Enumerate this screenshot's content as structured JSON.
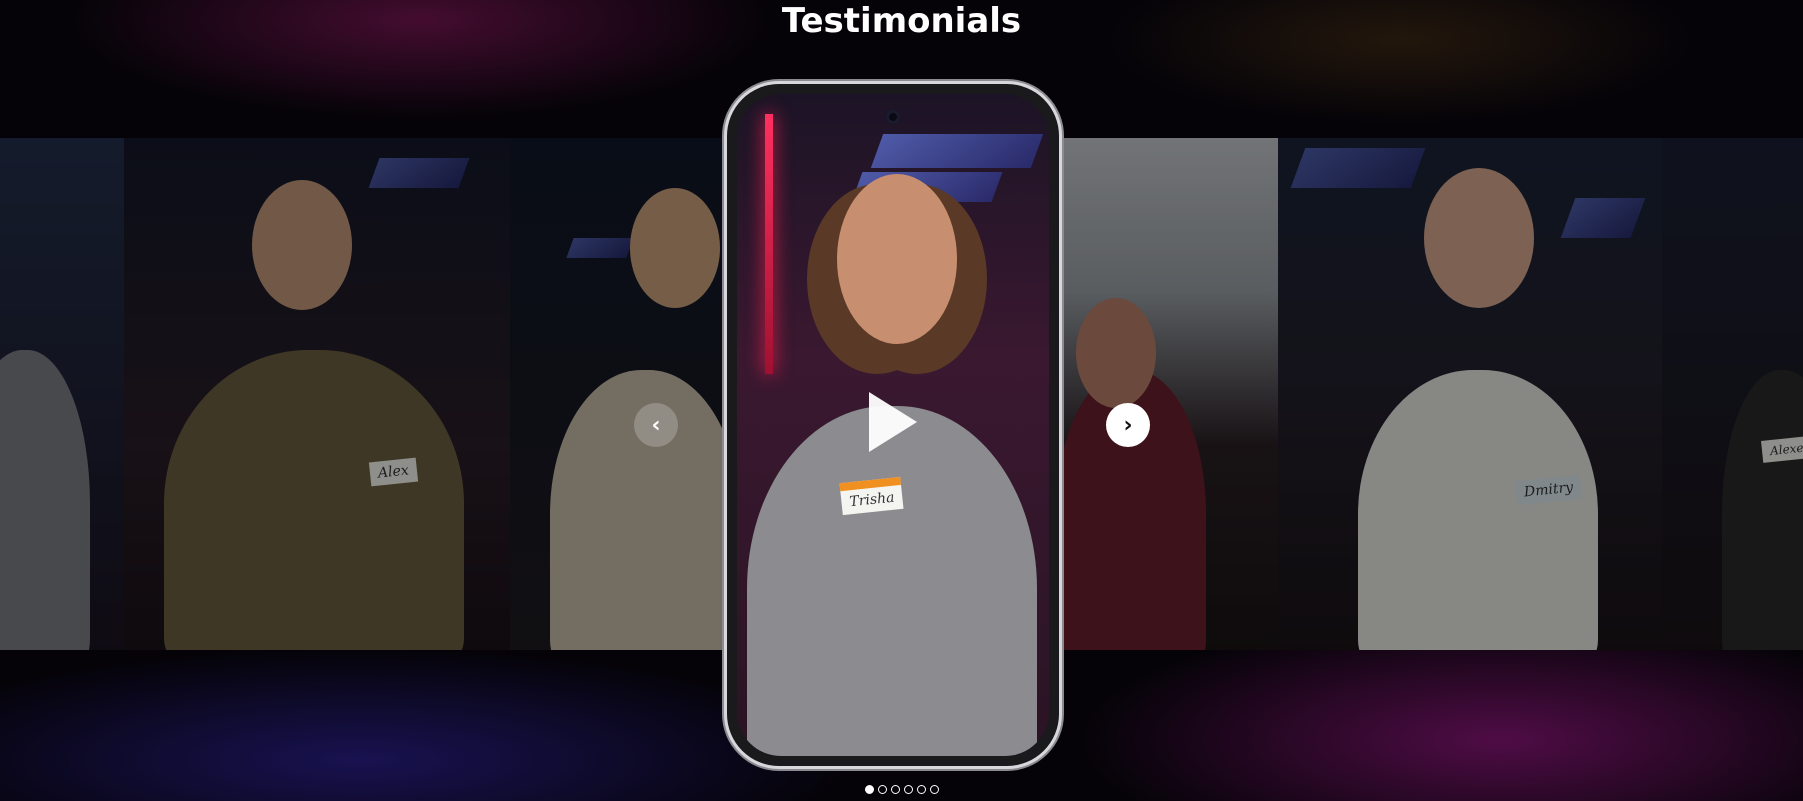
{
  "section": {
    "title": "Testimonials"
  },
  "slides": [
    {
      "name_tag": ""
    },
    {
      "name_tag": "Alex"
    },
    {
      "name_tag": ""
    },
    {
      "name_tag": "Trisha"
    },
    {
      "name_tag": ""
    },
    {
      "name_tag": "Dmitry"
    },
    {
      "name_tag": "Alexey"
    }
  ],
  "carousel": {
    "prev_icon": "chevron-left-icon",
    "next_icon": "chevron-right-icon",
    "play_icon": "play-icon",
    "prev_glyph": "‹",
    "next_glyph": "›",
    "dot_count": 6,
    "active_dot": 0
  },
  "colors": {
    "accent_neon": "#ff3060",
    "background": "#050308"
  }
}
